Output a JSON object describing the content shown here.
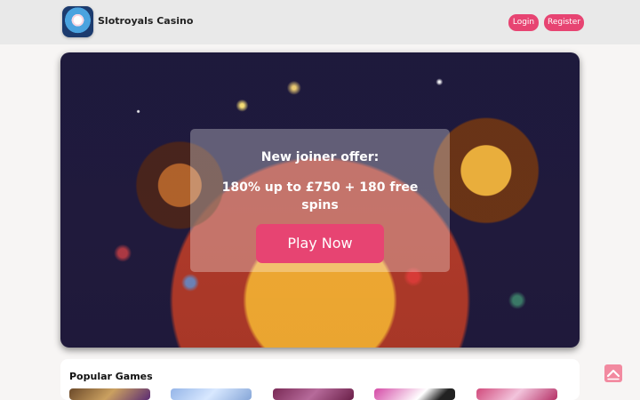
{
  "header": {
    "brand": "Slotroyals Casino",
    "login": "Login",
    "register": "Register"
  },
  "hero": {
    "offer_title": "New joiner offer:",
    "offer_desc": "180% up to £750 + 180 free spins",
    "play_label": "Play Now"
  },
  "games": {
    "title": "Popular Games"
  },
  "colors": {
    "accent": "#e74472",
    "header_bg": "#e9e9e9"
  },
  "icons": {
    "logo": "casino-logo",
    "back_to_top": "chevron-up-icon"
  }
}
